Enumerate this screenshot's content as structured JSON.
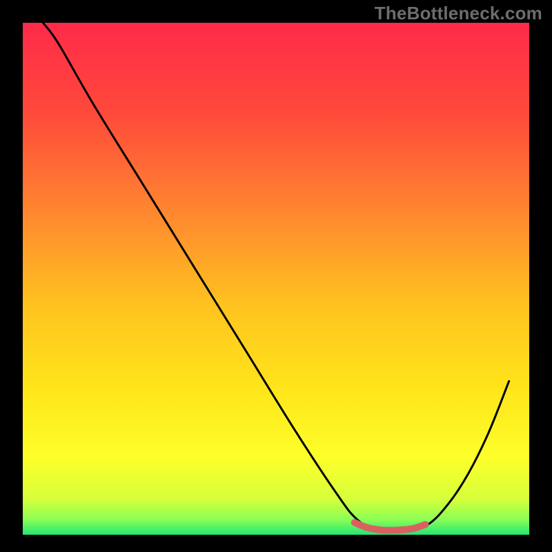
{
  "watermark": "TheBottleneck.com",
  "colors": {
    "background": "#000000",
    "watermark": "#6d6d6d",
    "curve": "#000000",
    "highlight": "#d96060",
    "gradient_stops": [
      {
        "offset": 0.0,
        "color": "#ff2a4a"
      },
      {
        "offset": 0.18,
        "color": "#ff4a3a"
      },
      {
        "offset": 0.38,
        "color": "#ff8a2f"
      },
      {
        "offset": 0.55,
        "color": "#ffc21f"
      },
      {
        "offset": 0.72,
        "color": "#ffe61a"
      },
      {
        "offset": 0.85,
        "color": "#fdff2a"
      },
      {
        "offset": 0.93,
        "color": "#d6ff3a"
      },
      {
        "offset": 0.97,
        "color": "#8cff55"
      },
      {
        "offset": 1.0,
        "color": "#22e574"
      }
    ]
  },
  "chart_data": {
    "type": "line",
    "title": "",
    "xlabel": "",
    "ylabel": "",
    "xlim": [
      0,
      100
    ],
    "ylim": [
      0,
      100
    ],
    "curve": [
      {
        "x": 4,
        "y": 100
      },
      {
        "x": 7,
        "y": 96
      },
      {
        "x": 14,
        "y": 84
      },
      {
        "x": 24,
        "y": 68
      },
      {
        "x": 34,
        "y": 52
      },
      {
        "x": 44,
        "y": 36
      },
      {
        "x": 54,
        "y": 20
      },
      {
        "x": 62,
        "y": 8
      },
      {
        "x": 66,
        "y": 3
      },
      {
        "x": 70,
        "y": 1
      },
      {
        "x": 76,
        "y": 1
      },
      {
        "x": 80,
        "y": 2
      },
      {
        "x": 84,
        "y": 6
      },
      {
        "x": 88,
        "y": 12
      },
      {
        "x": 92,
        "y": 20
      },
      {
        "x": 96,
        "y": 30
      }
    ],
    "highlight_segment": [
      {
        "x": 65.5,
        "y": 2.4
      },
      {
        "x": 68,
        "y": 1.4
      },
      {
        "x": 71,
        "y": 0.9
      },
      {
        "x": 74,
        "y": 0.9
      },
      {
        "x": 77,
        "y": 1.2
      },
      {
        "x": 79.5,
        "y": 2.0
      }
    ]
  }
}
